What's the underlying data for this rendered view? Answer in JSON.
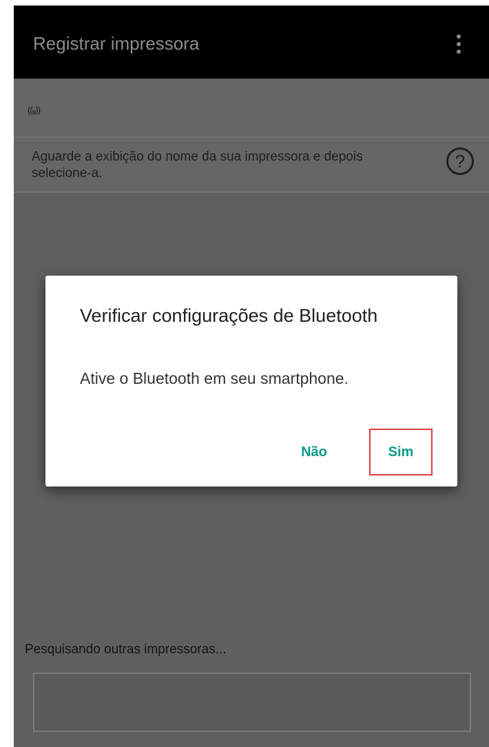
{
  "appbar": {
    "title": "Registrar impressora",
    "menu_icon": "overflow-menu-icon"
  },
  "signal_row": {
    "icon": "wireless-signal-icon",
    "icon_glyph": "((ᵩ))"
  },
  "instructions": {
    "text": "Aguarde a exibição do nome da sua impressora e depois selecione-a.",
    "help_icon": "help-icon",
    "help_glyph": "?"
  },
  "dialog": {
    "title": "Verificar configurações de Bluetooth",
    "message": "Ative o Bluetooth em seu smartphone.",
    "no_label": "Não",
    "yes_label": "Sim"
  },
  "search": {
    "status": "Pesquisando outras impressoras..."
  },
  "colors": {
    "appbar_bg": "#000000",
    "screen_dim": "#5f5f5f",
    "dialog_bg": "#ffffff",
    "accent": "#0a9a8a",
    "highlight": "#e23b3b"
  }
}
